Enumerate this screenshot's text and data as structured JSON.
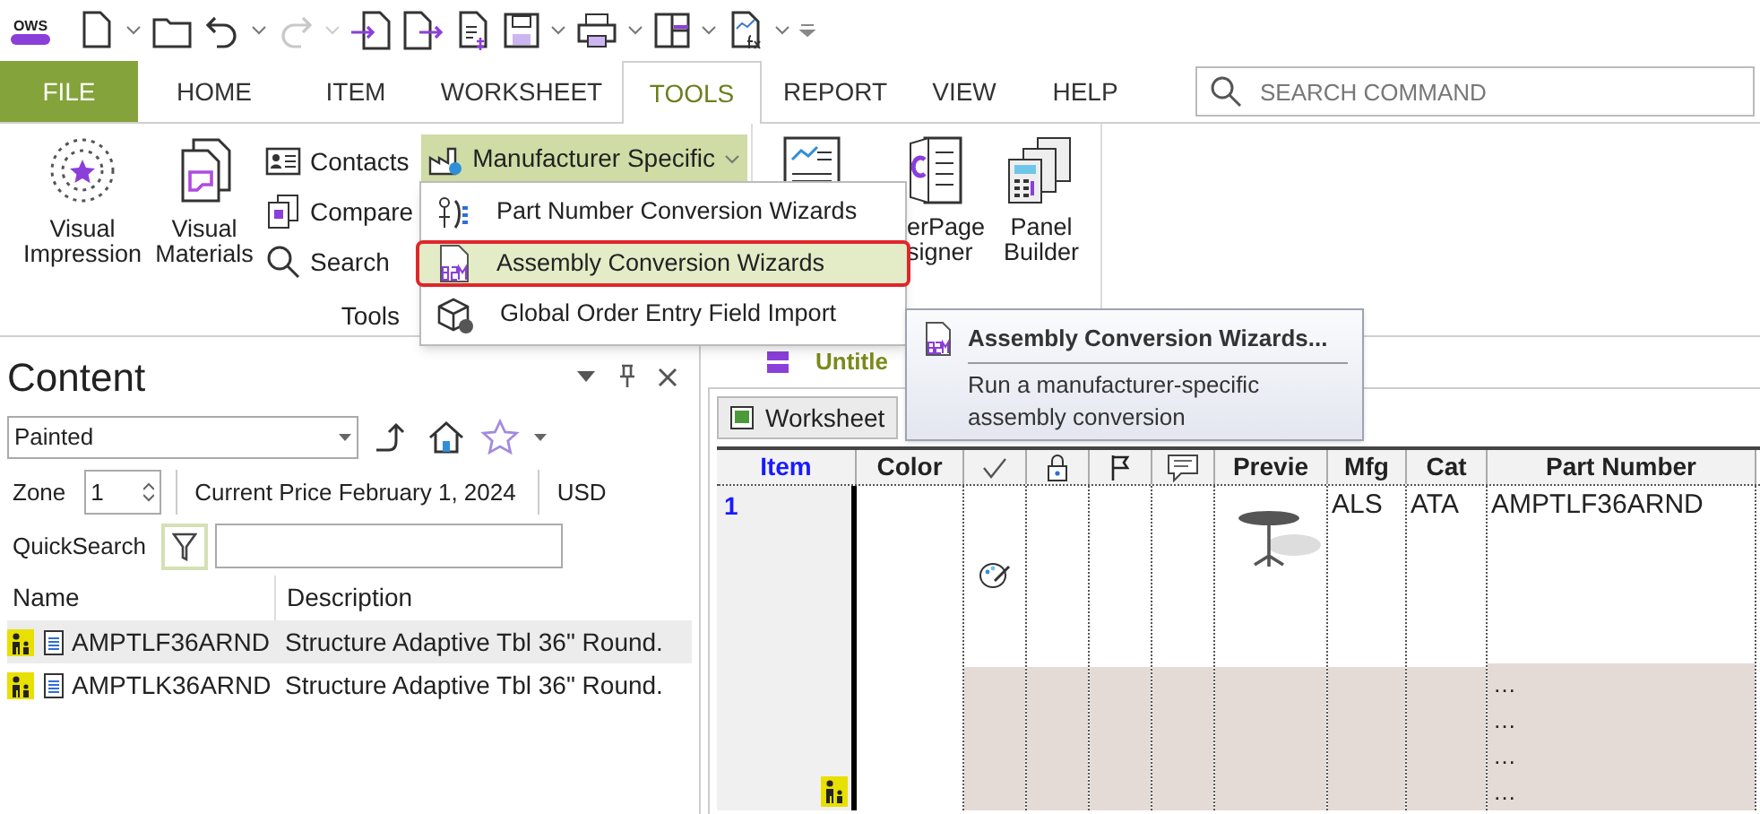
{
  "quick_access": {
    "logo": "OWS",
    "redo_disabled": true
  },
  "ribbon": {
    "tabs": [
      {
        "label": "FILE",
        "kind": "file",
        "selected": false
      },
      {
        "label": "HOME",
        "kind": "tab",
        "selected": false
      },
      {
        "label": "ITEM",
        "kind": "tab",
        "selected": false
      },
      {
        "label": "WORKSHEET",
        "kind": "tab",
        "selected": false
      },
      {
        "label": "TOOLS",
        "kind": "tab",
        "selected": true
      },
      {
        "label": "REPORT",
        "kind": "tab",
        "selected": false
      },
      {
        "label": "VIEW",
        "kind": "tab",
        "selected": false
      },
      {
        "label": "HELP",
        "kind": "tab",
        "selected": false
      }
    ],
    "search": {
      "placeholder": "SEARCH COMMAND"
    },
    "tools_group": {
      "label": "Tools",
      "large_buttons": [
        "Visual Impression",
        "Visual Materials"
      ],
      "small_buttons": [
        "Contacts",
        "Compare",
        "Search"
      ],
      "manufacturer_button": {
        "label": "Manufacturer Specific",
        "expanded": true
      }
    },
    "next_group": {
      "buttons": [
        "erPage signer",
        "Panel Builder"
      ]
    }
  },
  "dropdown_menu": {
    "items": [
      {
        "label": "Part Number Conversion Wizards",
        "selected": false
      },
      {
        "label": "Assembly Conversion Wizards",
        "selected": true
      },
      {
        "label": "Global Order Entry Field Import",
        "selected": false
      }
    ]
  },
  "tooltip": {
    "title": "Assembly Conversion Wizards...",
    "description": "Run a manufacturer-specific assembly conversion"
  },
  "content_panel": {
    "title": "Content",
    "category": "Painted",
    "zone_label": "Zone",
    "zone": "1",
    "price_list": "Current Price February 1, 2024",
    "currency": "USD",
    "quicksearch_label": "QuickSearch",
    "columns": [
      "Name",
      "Description"
    ],
    "rows": [
      {
        "name": "AMPTLF36ARND",
        "description": "Structure Adaptive Tbl 36\" Round.",
        "selected": true
      },
      {
        "name": "AMPTLK36ARND",
        "description": "Structure Adaptive Tbl 36\" Round.",
        "selected": false
      }
    ]
  },
  "document": {
    "title": "Untitle",
    "sheet_tab": "Worksheet",
    "grid": {
      "columns": [
        {
          "label": "Item",
          "kind": "item"
        },
        {
          "label": "Color",
          "kind": "text"
        },
        {
          "kind": "icon"
        },
        {
          "kind": "icon"
        },
        {
          "kind": "icon"
        },
        {
          "kind": "icon"
        },
        {
          "label": "Previe",
          "kind": "text"
        },
        {
          "label": "Mfg",
          "kind": "text"
        },
        {
          "label": "Cat",
          "kind": "text"
        },
        {
          "label": "Part Number",
          "kind": "text"
        }
      ],
      "rows": [
        {
          "item": "1",
          "mfg": "ALS",
          "cat": "ATA",
          "part_number": "AMPTLF36ARND",
          "continuation": [
            "…",
            "…",
            "…",
            "…"
          ]
        }
      ]
    }
  }
}
